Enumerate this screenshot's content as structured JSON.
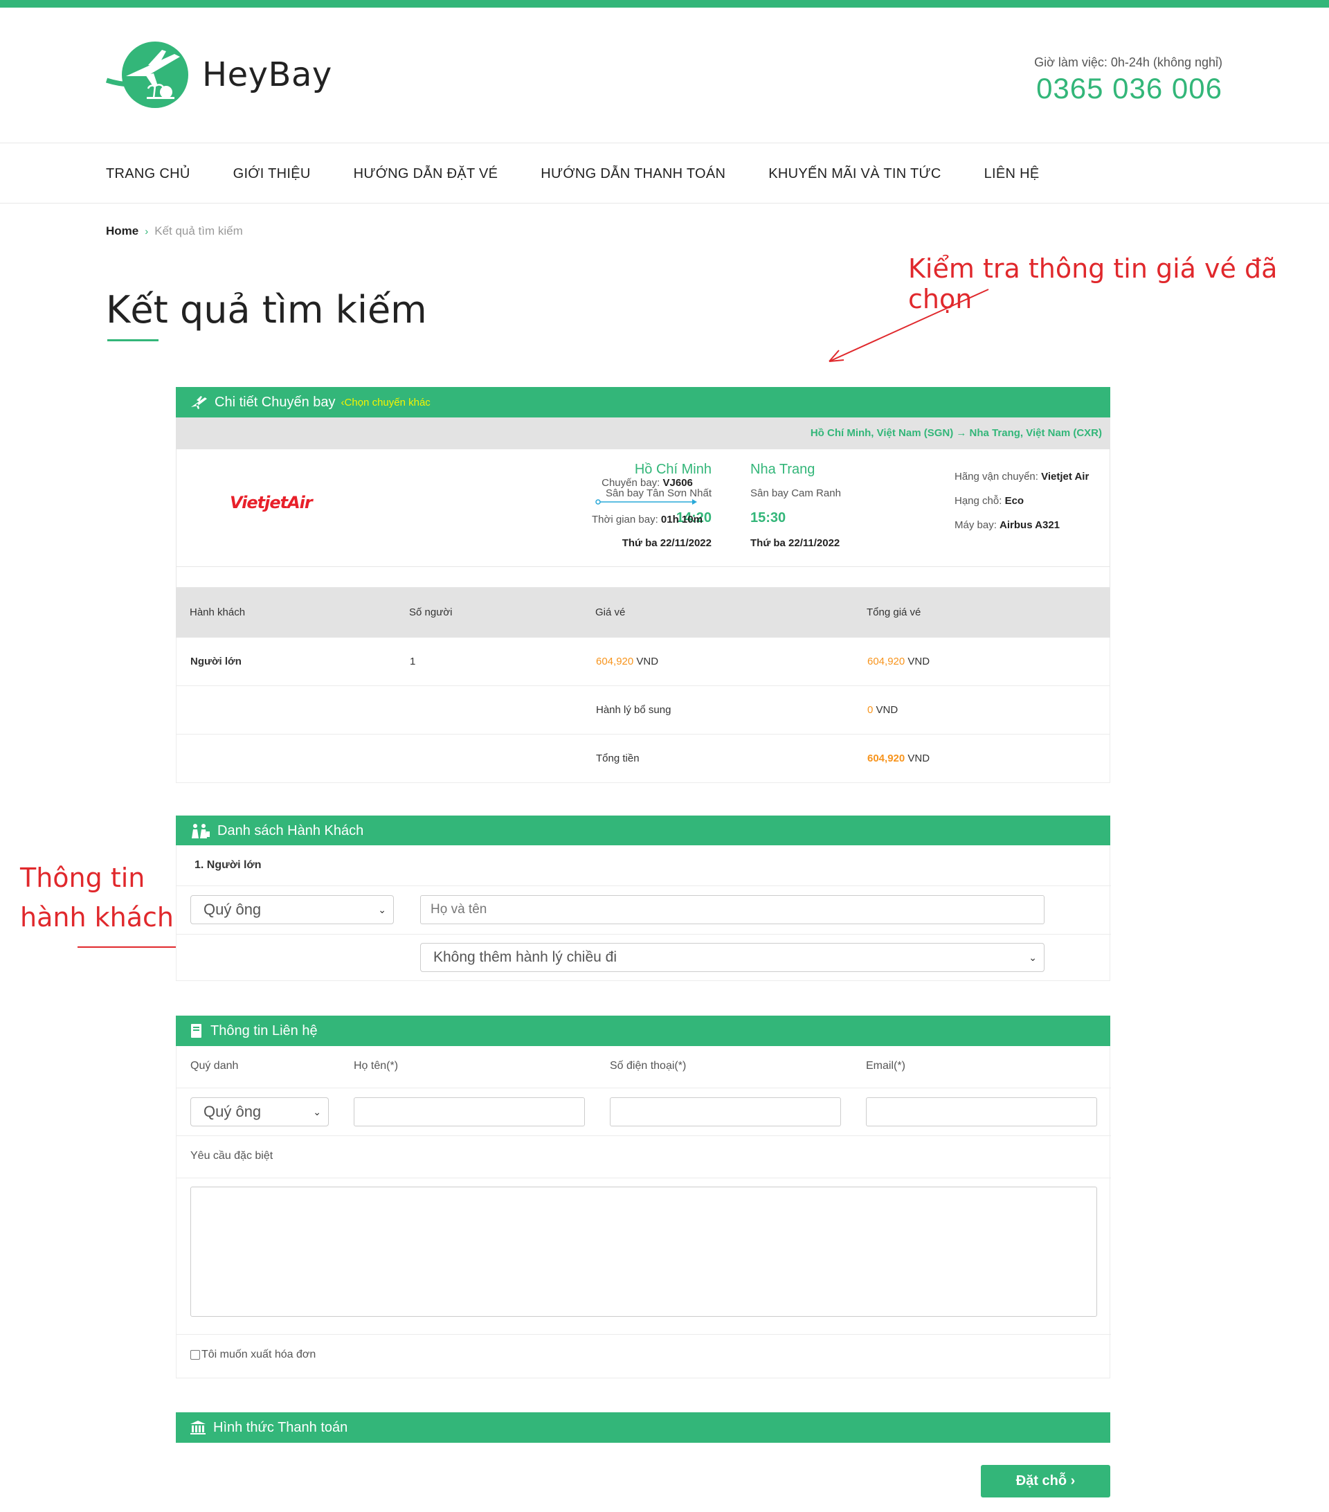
{
  "header": {
    "logo_text": "HeyBay",
    "work_hours": "Giờ làm việc: 0h-24h (không nghỉ)",
    "hotline": "0365 036 006"
  },
  "nav": {
    "items": [
      "TRANG CHỦ",
      "GIỚI THIỆU",
      "HƯỚNG DẪN ĐẶT VÉ",
      "HƯỚNG DẪN THANH TOÁN",
      "KHUYẾN MÃI VÀ TIN TỨC",
      "LIÊN HỆ"
    ]
  },
  "breadcrumb": {
    "home": "Home",
    "separator": "›",
    "current": "Kết quả tìm kiếm"
  },
  "page_title": "Kết quả tìm kiếm",
  "annotations": {
    "check_price": "Kiểm tra thông tin giá vé đã chọn",
    "passenger_line1": "Thông tin",
    "passenger_line2": "hành khách"
  },
  "flight_panel": {
    "title": "Chi tiết Chuyến bay",
    "change_link": "‹Chọn chuyến khác",
    "route": "Hồ Chí Minh, Việt Nam (SGN) → Nha Trang, Việt Nam (CXR)",
    "airline_logo_text": "VietjetAir",
    "from": {
      "city": "Hồ Chí Minh",
      "airport": "Sân bay Tân Sơn Nhất",
      "time": "14:20",
      "date": "Thứ ba 22/11/2022"
    },
    "to": {
      "city": "Nha Trang",
      "airport": "Sân bay Cam Ranh",
      "time": "15:30",
      "date": "Thứ ba 22/11/2022"
    },
    "flight_no_label": "Chuyến bay:",
    "flight_no": "VJ606",
    "duration_label": "Thời gian bay:",
    "duration": "01h 10m",
    "carrier_label": "Hãng vận chuyển:",
    "carrier": "Vietjet Air",
    "class_label": "Hạng chỗ:",
    "class": "Eco",
    "aircraft_label": "Máy bay:",
    "aircraft": "Airbus A321"
  },
  "price_table": {
    "headers": [
      "Hành khách",
      "Số người",
      "Giá vé",
      "Tổng giá vé"
    ],
    "adult": {
      "label": "Người lớn",
      "count": "1",
      "price": "604,920",
      "total": "604,920"
    },
    "currency": "VND",
    "baggage_label": "Hành lý bổ sung",
    "baggage_value": "0",
    "grand_total_label": "Tổng tiền",
    "grand_total": "604,920"
  },
  "passenger_panel": {
    "title": "Danh sách Hành Khách",
    "passenger_label": "1. Người lớn",
    "title_select": "Quý ông",
    "name_placeholder": "Họ và tên",
    "baggage_select": "Không thêm hành lý chiều đi"
  },
  "contact_panel": {
    "title": "Thông tin Liên hệ",
    "label_title": "Quý danh",
    "label_name": "Họ tên(*)",
    "label_phone": "Số điện thoại(*)",
    "label_email": "Email(*)",
    "title_select": "Quý ông",
    "special_request_label": "Yêu cầu đặc biệt",
    "invoice_label": "Tôi muốn xuất hóa đơn"
  },
  "payment_panel": {
    "title": "Hình thức Thanh toán"
  },
  "book_button": "Đặt chỗ ›",
  "colors": {
    "brand_green": "#33b679",
    "price_orange": "#f7941d",
    "annotation_red": "#e0282c",
    "link_yellow": "#f4f400"
  }
}
